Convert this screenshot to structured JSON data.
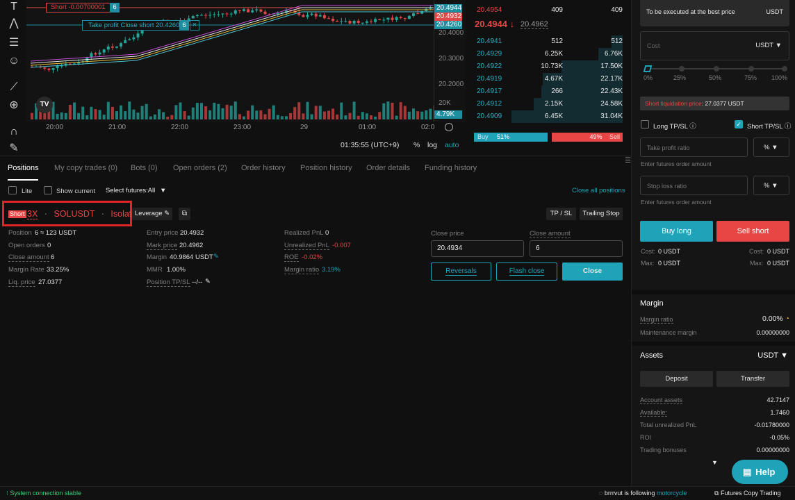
{
  "chart": {
    "order_line": {
      "label": "Short -0.00700001",
      "qty": "6"
    },
    "tp_line": {
      "label": "Take profit Close short 20.4260",
      "qty": "6",
      "close": "×"
    },
    "price_axis": [
      "20.4000",
      "20.3000",
      "20.2000"
    ],
    "price_tags": [
      {
        "text": "20.4944",
        "color": "#1d8fa0"
      },
      {
        "text": "20.4932",
        "color": "#e04848"
      },
      {
        "text": "20.4260",
        "color": "#1d8fa0"
      }
    ],
    "volume_axis": "20K",
    "volume_tag": "4.79K",
    "time_labels": [
      "20:00",
      "21:00",
      "22:00",
      "23:00",
      "29",
      "01:00",
      "02:0"
    ],
    "clock": "01:35:55 (UTC+9)",
    "pct": "%",
    "log": "log",
    "auto": "auto",
    "tv_logo": "TV"
  },
  "orderbook": {
    "top": {
      "price": "20.4954",
      "amount": "409",
      "cumulative": "409"
    },
    "last_price": "20.4944",
    "last_arrow": "↓",
    "mark_price": "20.4962",
    "bids": [
      {
        "price": "20.4941",
        "amount": "512",
        "cumulative": "512",
        "depth": 0.1
      },
      {
        "price": "20.4929",
        "amount": "6.25K",
        "cumulative": "6.76K",
        "depth": 0.22
      },
      {
        "price": "20.4922",
        "amount": "10.73K",
        "cumulative": "17.50K",
        "depth": 0.55
      },
      {
        "price": "20.4919",
        "amount": "4.67K",
        "cumulative": "22.17K",
        "depth": 0.72
      },
      {
        "price": "20.4917",
        "amount": "266",
        "cumulative": "22.43K",
        "depth": 0.73
      },
      {
        "price": "20.4912",
        "amount": "2.15K",
        "cumulative": "24.58K",
        "depth": 0.8
      },
      {
        "price": "20.4909",
        "amount": "6.45K",
        "cumulative": "31.04K",
        "depth": 1.0
      }
    ],
    "buy_label": "Buy",
    "buy_pct": "51%",
    "buy_ratio": 0.51,
    "sell_pct": "49%",
    "sell_label": "Sell"
  },
  "tabs": [
    "Positions",
    "My copy trades (0)",
    "Bots (0)",
    "Open orders (2)",
    "Order history",
    "Position history",
    "Order details",
    "Funding history"
  ],
  "filters": {
    "lite": "Lite",
    "show_current": "Show current",
    "select_futures": "Select futures:All",
    "close_all": "Close all positions"
  },
  "position": {
    "side": "Short",
    "leverage": "3X",
    "symbol": "SOLUSDT",
    "margin_mode": "Isolated",
    "sep": "·",
    "leverage_button": "Leverage",
    "tpsl_button": "TP / SL",
    "trailing_button": "Trailing Stop",
    "fields": {
      "position": {
        "label": "Position",
        "value": "6 ≈ 123 USDT"
      },
      "open_orders": {
        "label": "Open orders",
        "value": "0"
      },
      "close_amount": {
        "label": "Close amount",
        "value": "6"
      },
      "margin_rate": {
        "label": "Margin Rate",
        "value": "33.25%"
      },
      "liq_price": {
        "label": "Liq. price",
        "value": "27.0377"
      },
      "entry_price": {
        "label": "Entry price",
        "value": "20.4932"
      },
      "mark_price": {
        "label": "Mark price",
        "value": "20.4962"
      },
      "margin": {
        "label": "Margin",
        "value": "40.9864 USDT"
      },
      "mmr": {
        "label": "MMR",
        "value": "1.00%"
      },
      "position_tpsl": {
        "label": "Position TP/SL",
        "value": "--/--"
      },
      "realized_pnl": {
        "label": "Realized PnL",
        "value": "0"
      },
      "unrealized_pnl": {
        "label": "Unrealized PnL",
        "value": "-0.007"
      },
      "roe": {
        "label": "ROE",
        "value": "-0.02%"
      },
      "margin_ratio": {
        "label": "Margin ratio",
        "value": "3.19%"
      }
    },
    "close_price_label": "Close price",
    "close_price_value": "20.4934",
    "close_amount_label": "Close amount",
    "close_amount_value": "6",
    "reversals": "Reversals",
    "flash_close": "Flash close",
    "close": "Close"
  },
  "order_panel": {
    "best_price_text": "To be executed at the best price",
    "best_price_unit": "USDT",
    "cost_placeholder": "Cost",
    "cost_unit": "USDT",
    "slider_marks": [
      "0%",
      "25%",
      "50%",
      "75%",
      "100%"
    ],
    "slider_value": 0,
    "liq_label": "Short liquidation price",
    "liq_value": "27.0377 USDT",
    "long_tpsl": "Long TP/SL",
    "short_tpsl": "Short TP/SL",
    "tp_placeholder": "Take profit ratio",
    "sl_placeholder": "Stop loss ratio",
    "ratio_unit": "%",
    "hint": "Enter futures order amount",
    "buy_long": "Buy long",
    "sell_short": "Sell short",
    "cost_label": "Cost:",
    "cost_value": "0 USDT",
    "max_label": "Max:",
    "max_value": "0 USDT"
  },
  "margin": {
    "title": "Margin",
    "ratio_label": "Margin ratio",
    "ratio_value": "0.00%",
    "maint_label": "Maintenance margin",
    "maint_value": "0.00000000"
  },
  "assets": {
    "title": "Assets",
    "currency": "USDT",
    "deposit": "Deposit",
    "transfer": "Transfer",
    "rows": [
      {
        "label": "Account assets",
        "value": "42.7147"
      },
      {
        "label": "Available:",
        "value": "1.7460"
      },
      {
        "label": "Total unrealized PnL",
        "value": "-0.01780000"
      },
      {
        "label": "ROI",
        "value": "-0.05%"
      },
      {
        "label": "Trading bonuses",
        "value": "0.00000000"
      }
    ]
  },
  "help": "Help",
  "footer": {
    "connection": "System connection stable",
    "user": "brrrvut",
    "following_text": "is following",
    "followed": "motorcycle",
    "copy_trading": "Futures Copy Trading"
  },
  "colors": {
    "accent": "#1fa3b8",
    "red": "#e84545",
    "highlight_box": "#e0262b"
  }
}
